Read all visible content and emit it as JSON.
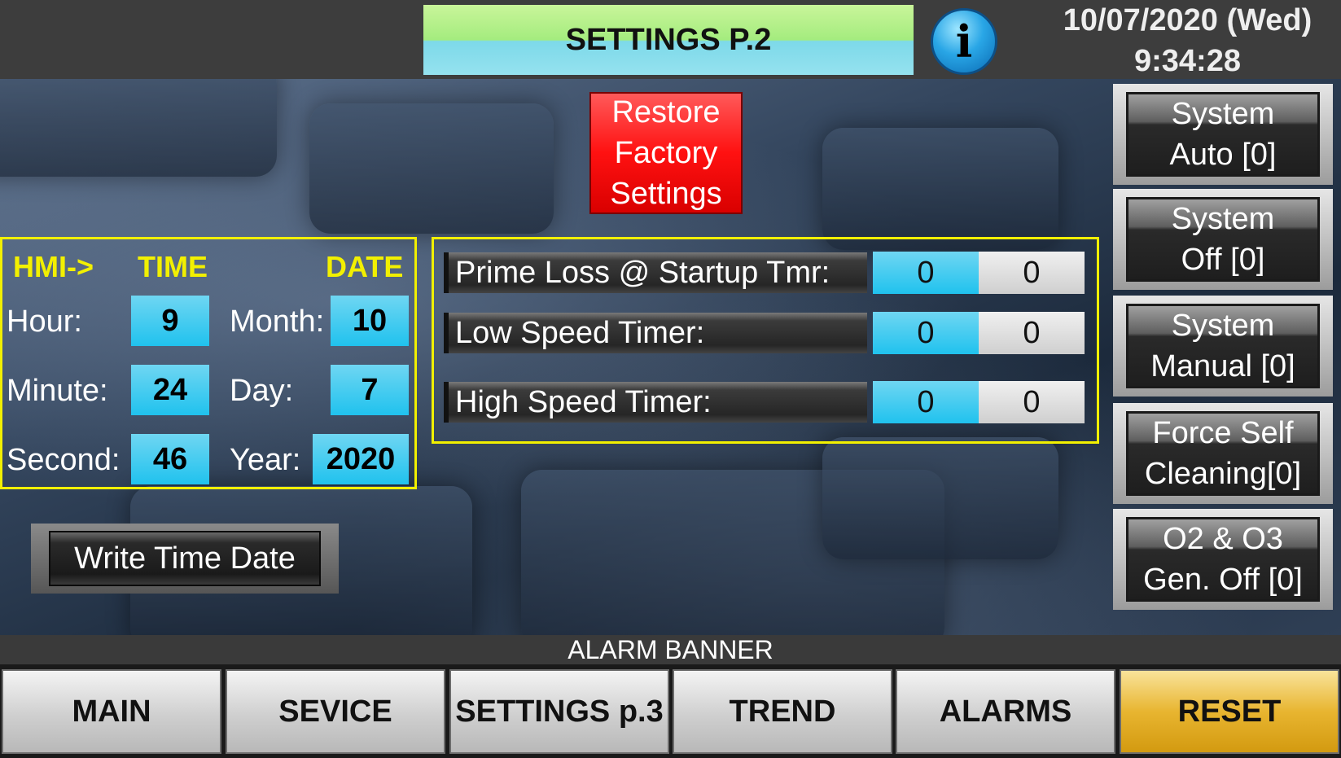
{
  "header": {
    "title": "SETTINGS P.2",
    "info_label": "i",
    "date": "10/07/2020 (Wed)",
    "time": "9:34:28"
  },
  "restore_button": {
    "line1": "Restore",
    "line2": "Factory",
    "line3": "Settings"
  },
  "time_date": {
    "hmi_label": "HMI->",
    "time_header": "TIME",
    "date_header": "DATE",
    "hour_label": "Hour:",
    "hour": "9",
    "minute_label": "Minute:",
    "minute": "24",
    "second_label": "Second:",
    "second": "46",
    "month_label": "Month:",
    "month": "10",
    "day_label": "Day:",
    "day": "7",
    "year_label": "Year:",
    "year": "2020",
    "write_label": "Write Time  Date"
  },
  "timers": [
    {
      "label": "Prime Loss @ Startup Tmr:",
      "setpoint": "0",
      "actual": "0"
    },
    {
      "label": "Low Speed Timer:",
      "setpoint": "0",
      "actual": "0"
    },
    {
      "label": "High Speed Timer:",
      "setpoint": "0",
      "actual": "0"
    }
  ],
  "side_buttons": [
    {
      "line1": "System",
      "line2": "Auto [0]"
    },
    {
      "line1": "System",
      "line2": "Off [0]"
    },
    {
      "line1": "System",
      "line2": "Manual [0]"
    },
    {
      "line1": "Force Self",
      "line2": "Cleaning[0]"
    },
    {
      "line1": "O2 & O3",
      "line2": "Gen. Off [0]"
    }
  ],
  "alarm_banner": "ALARM BANNER",
  "nav": {
    "main": "MAIN",
    "service": "SEVICE",
    "settings3": "SETTINGS p.3",
    "trend": "TREND",
    "alarms": "ALARMS",
    "reset": "RESET"
  },
  "colors": {
    "accent_yellow": "#f2f000",
    "field_blue": "#20c2ee",
    "restore_red": "#f11111",
    "reset_gold": "#e8b530"
  }
}
